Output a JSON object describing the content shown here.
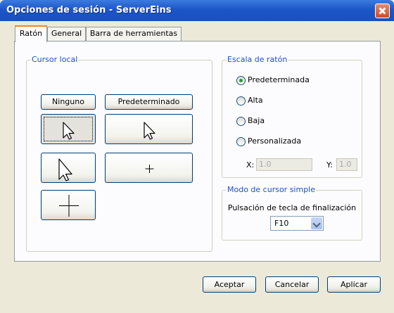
{
  "window": {
    "title": "Opciones de sesión - ServerEins"
  },
  "tabs": [
    {
      "label": "Ratón",
      "active": true
    },
    {
      "label": "General",
      "active": false
    },
    {
      "label": "Barra de herramientas",
      "active": false
    }
  ],
  "cursor_local": {
    "legend": "Cursor local",
    "none_button": "Ninguno",
    "default_button": "Predeterminado",
    "cursor_options": [
      {
        "icon": "arrow-outline-cursor-icon",
        "selected": true
      },
      {
        "icon": "arrow-outline-cursor-icon",
        "selected": false
      },
      {
        "icon": "arrow-large-cursor-icon",
        "selected": false
      },
      {
        "icon": "crosshair-small-cursor-icon",
        "selected": false
      },
      {
        "icon": "crosshair-large-cursor-icon",
        "selected": false
      }
    ]
  },
  "mouse_scale": {
    "legend": "Escala de ratón",
    "options": [
      {
        "label": "Predeterminada",
        "checked": true
      },
      {
        "label": "Alta",
        "checked": false
      },
      {
        "label": "Baja",
        "checked": false
      },
      {
        "label": "Personalizada",
        "checked": false
      }
    ],
    "x_label": "X:",
    "x_value": "1.0",
    "y_label": "Y:",
    "y_value": "1.0"
  },
  "simple_cursor": {
    "legend": "Modo de cursor simple",
    "key_label": "Pulsación de tecla de finalización",
    "key_value": "F10"
  },
  "buttons": {
    "accept": "Aceptar",
    "cancel": "Cancelar",
    "apply": "Aplicar"
  },
  "colors": {
    "titlebar": "#1c56c9",
    "accent_tab": "#e68b2c",
    "legend_text": "#1f4fcd",
    "close_button": "#d14a22"
  }
}
